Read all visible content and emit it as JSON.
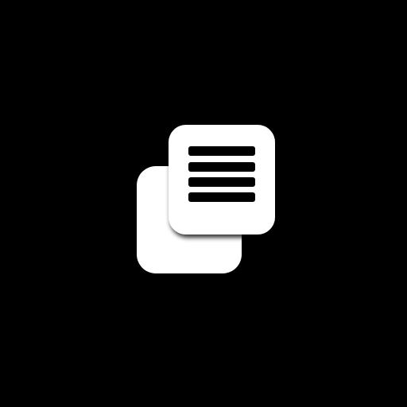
{
  "icon": {
    "name": "copy-documents-icon",
    "background_color": "#000000",
    "foreground_color": "#ffffff",
    "line_color": "#000000"
  }
}
